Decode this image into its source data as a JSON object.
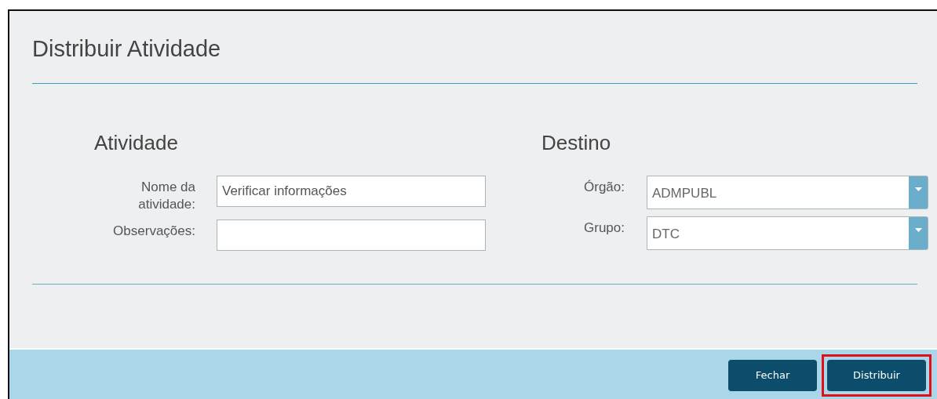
{
  "dialog": {
    "title": "Distribuir Atividade"
  },
  "sections": [
    {
      "heading": "Atividade",
      "fields": [
        {
          "kind": "text",
          "label": "Nome da atividade:",
          "value": "Verificar informações"
        },
        {
          "kind": "text",
          "label": "Observações:"
        }
      ]
    },
    {
      "heading": "Destino",
      "fields": [
        {
          "kind": "select",
          "label": "Órgão:",
          "value": "ADMPUBL"
        },
        {
          "kind": "select",
          "label": "Grupo:",
          "value": "DTC"
        }
      ]
    }
  ],
  "buttons": [
    {
      "label": "Fechar",
      "highlighted": false
    },
    {
      "label": "Distribuir",
      "highlighted": true
    }
  ]
}
